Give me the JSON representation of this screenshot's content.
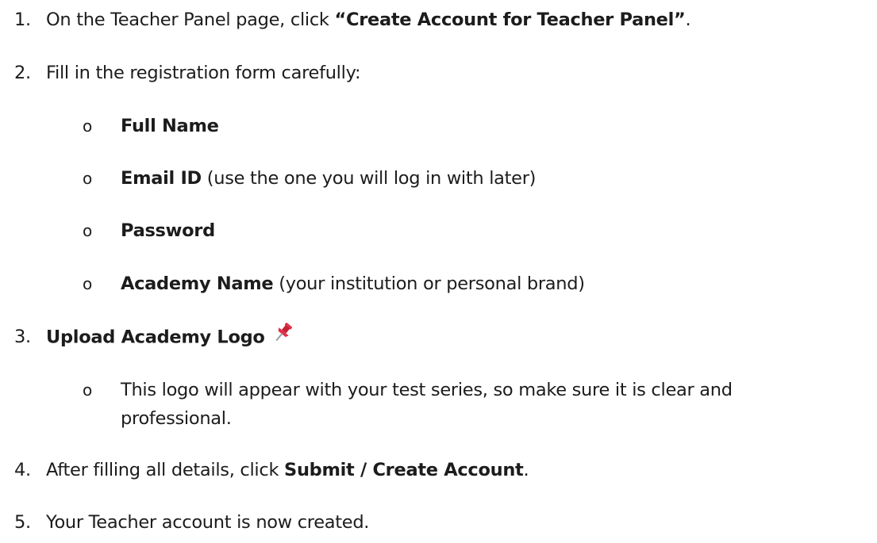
{
  "steps": [
    {
      "number": "1.",
      "prefix": "On the Teacher Panel page, click ",
      "bold": "“Create Account for Teacher Panel”",
      "suffix": "."
    },
    {
      "number": "2.",
      "text": "Fill in the registration form carefully:",
      "fields": [
        {
          "bullet": "o",
          "label": "Full Name",
          "note": ""
        },
        {
          "bullet": "o",
          "label": "Email ID",
          "note": " (use the one you will log in with later)"
        },
        {
          "bullet": "o",
          "label": "Password",
          "note": ""
        },
        {
          "bullet": "o",
          "label": "Academy Name",
          "note": " (your institution or personal brand)"
        }
      ]
    },
    {
      "number": "3.",
      "bold": "Upload Academy Logo",
      "icon": "pushpin-icon",
      "sub": {
        "bullet": "o",
        "line1": "This logo will appear with your test series, so make sure it is clear and",
        "line2": "professional."
      }
    },
    {
      "number": "4.",
      "prefix": "After filling all details, click ",
      "bold": "Submit / Create Account",
      "suffix": "."
    },
    {
      "number": "5.",
      "text": "Your Teacher account is now created."
    }
  ],
  "colors": {
    "text": "#1c1c1c",
    "pin_red": "#e0334a"
  }
}
